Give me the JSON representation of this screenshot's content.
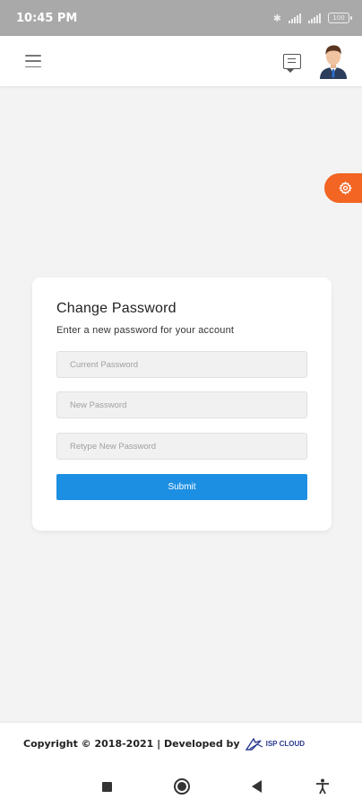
{
  "status_bar": {
    "time": "10:45 PM",
    "battery": "100"
  },
  "header": {
    "menu_icon": "hamburger-icon",
    "messages_icon": "chat-icon",
    "avatar_icon": "user-avatar"
  },
  "settings_tab": {
    "icon": "gear-icon",
    "color": "#f26522"
  },
  "change_password": {
    "title": "Change Password",
    "subtitle": "Enter a new password for your account",
    "current_password_placeholder": "Current Password",
    "new_password_placeholder": "New Password",
    "retype_password_placeholder": "Retype New Password",
    "submit_label": "Submit",
    "submit_color": "#1d8fe3"
  },
  "footer": {
    "copyright": "Copyright © 2018-2021 | Developed by",
    "logo_text": "ISP CLOUD"
  },
  "nav_bar": {
    "recents_icon": "square-icon",
    "home_icon": "home-circle-icon",
    "back_icon": "back-triangle-icon",
    "accessibility_icon": "accessibility-icon"
  }
}
